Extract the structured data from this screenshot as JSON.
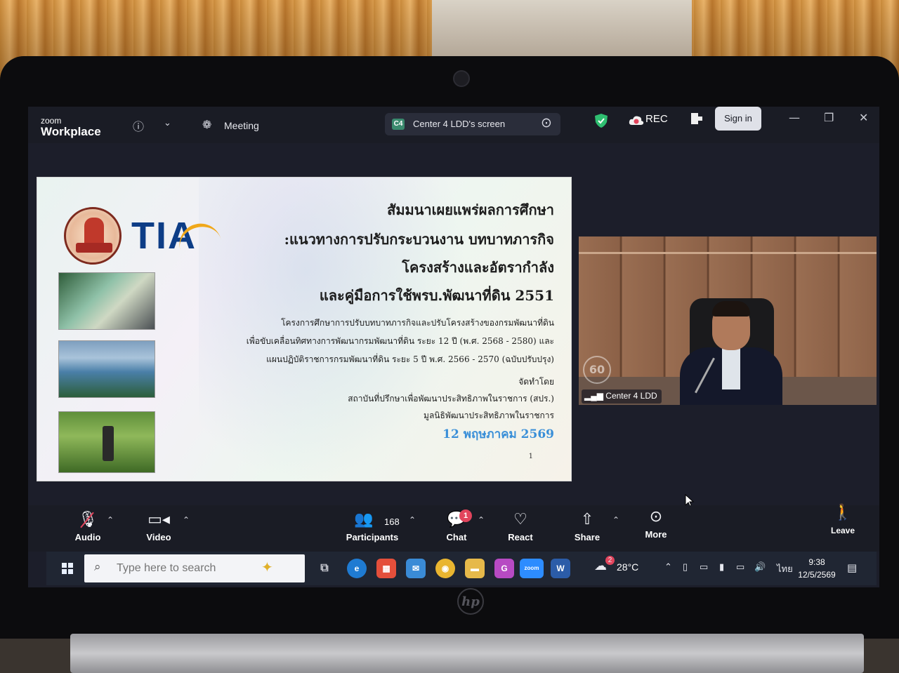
{
  "zoom_header": {
    "brand_top": "zoom",
    "brand_bottom": "Workplace",
    "meeting_label": "Meeting",
    "screen_badge": "C4",
    "screen_label": "Center 4 LDD's screen",
    "rec_label": "REC",
    "sign_in": "Sign in"
  },
  "slide": {
    "logo_text": "TIA",
    "title_lines": [
      "สัมมนาเผยแพร่ผลการศึกษา",
      ":แนวทางการปรับกระบวนงาน บทบาทภารกิจ",
      "โครงสร้างและอัตรากำลัง",
      "และคู่มือการใช้พรบ.พัฒนาที่ดิน 2551"
    ],
    "sub_lines": [
      "โครงการศึกษาการปรับบทบาทภารกิจและปรับโครงสร้างของกรมพัฒนาที่ดิน",
      "เพื่อขับเคลื่อนทิศทางการพัฒนากรมพัฒนาที่ดิน ระยะ 12 ปี (พ.ศ. 2568 - 2580) และ",
      "แผนปฏิบัติราชการกรมพัฒนาที่ดิน ระยะ 5 ปี พ.ศ. 2566 - 2570 (ฉบับปรับปรุง)"
    ],
    "prepared_by": "จัดทำโดย",
    "org1": "สถาบันที่ปรึกษาเพื่อพัฒนาประสิทธิภาพในราชการ (สปร.)",
    "org2": "มูลนิธิพัฒนาประสิทธิภาพในราชการ",
    "date": "12 พฤษภาคม 2569",
    "page_number": "1"
  },
  "video": {
    "participant_label": "Center 4 LDD"
  },
  "toolbar": {
    "audio": "Audio",
    "video": "Video",
    "participants": "Participants",
    "participants_count": "168",
    "chat": "Chat",
    "chat_badge": "1",
    "react": "React",
    "share": "Share",
    "more": "More",
    "leave": "Leave"
  },
  "taskbar": {
    "search_placeholder": "Type here to search",
    "zoom_app": "zoom",
    "temperature": "28°C",
    "weather_badge": "2",
    "language": "ไทย",
    "time": "9:38",
    "date": "12/5/2569"
  },
  "colors": {
    "zoom_bg": "#1a1c25",
    "accent_red": "#e2445c",
    "date_blue": "#3a8fd8",
    "tia_blue": "#0d3d86"
  }
}
